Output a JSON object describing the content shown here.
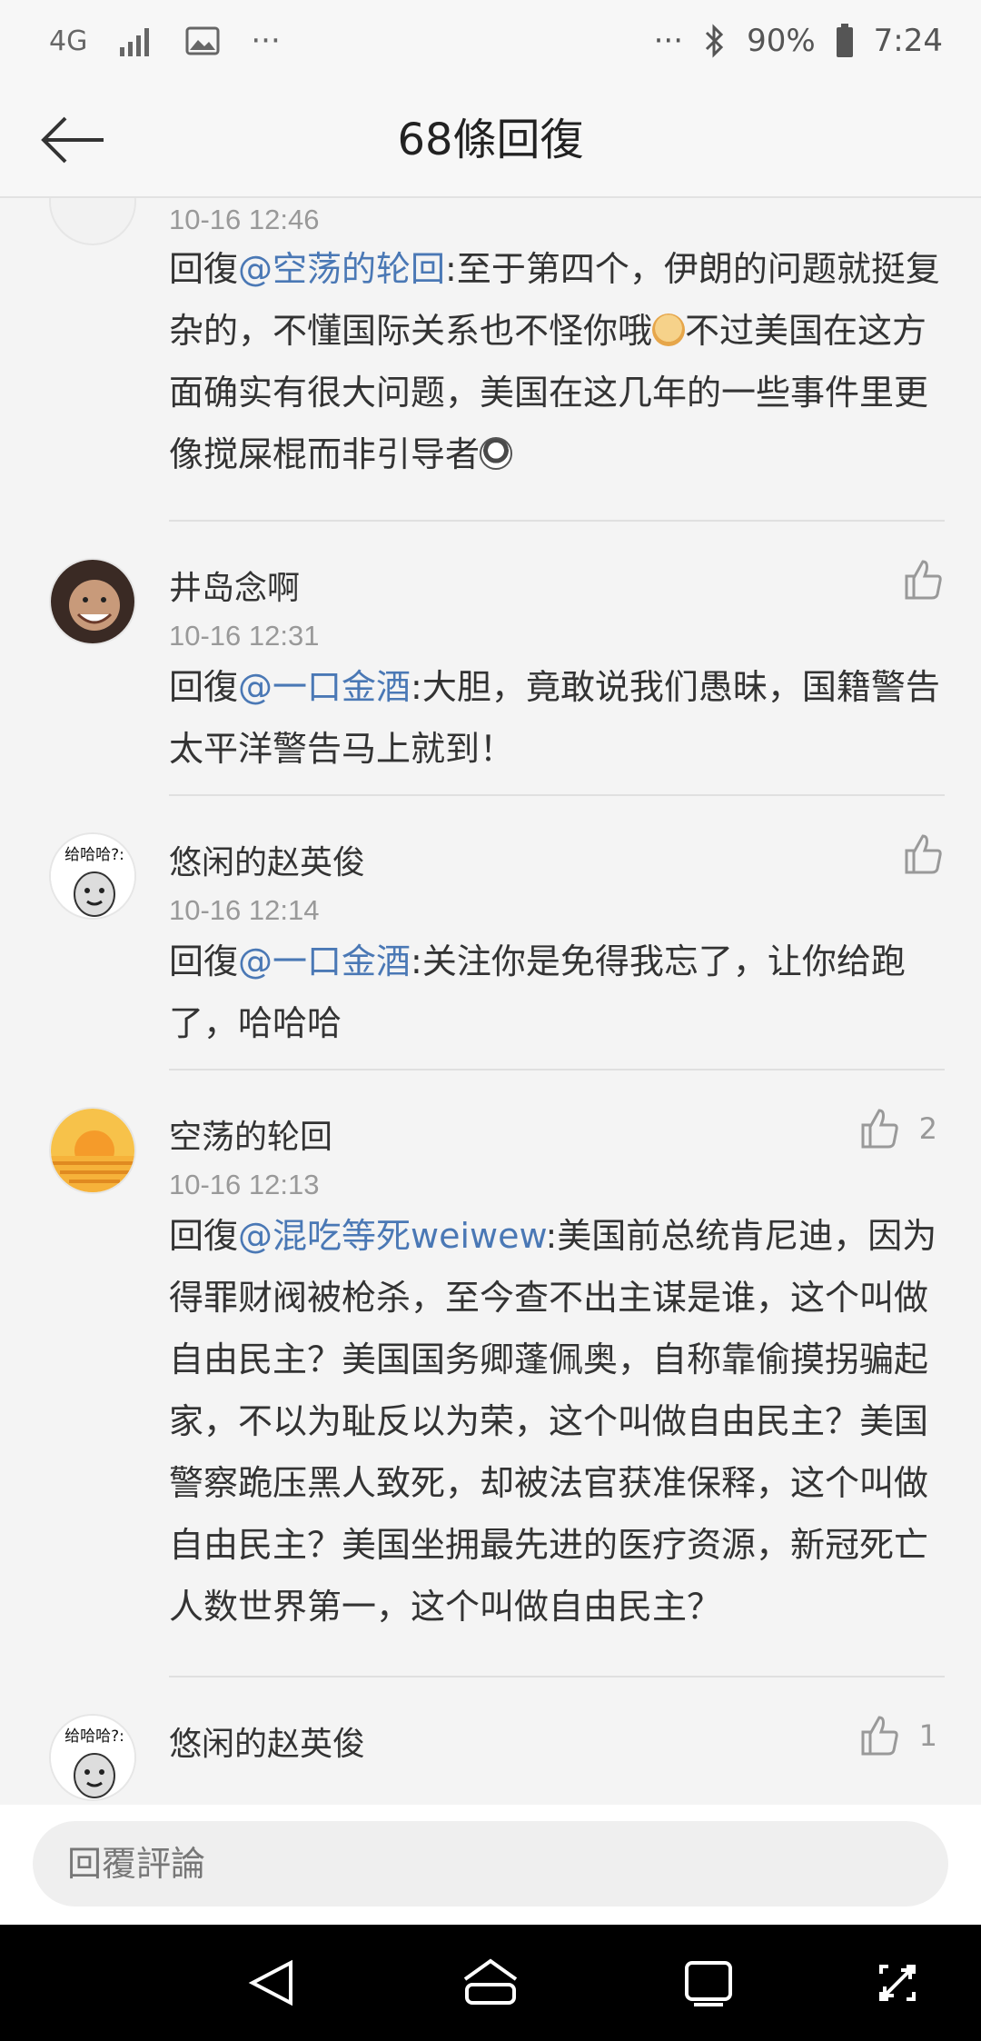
{
  "status_bar": {
    "network": "4G",
    "more_left": "···",
    "more_right": "···",
    "battery": "90%",
    "time": "7:24"
  },
  "header": {
    "title": "68條回復"
  },
  "comments": [
    {
      "time": "10-16 12:46",
      "reply_prefix": "回復",
      "mention": "@空荡的轮回",
      "text": ":至于第四个，伊朗的问题就挺复杂的，不懂国际关系也不怪你哦",
      "text2": "不过美国在这方面确实有很大问题，美国在这几年的一些事件里更像搅屎棍而非引导者",
      "emoji1": "doge-emoji",
      "emoji2": "tongue-emoji"
    },
    {
      "user": "井岛念啊",
      "time": "10-16 12:31",
      "reply_prefix": "回復",
      "mention": "@一口金酒",
      "text": ":大胆，竟敢说我们愚昧，国籍警告太平洋警告马上就到！"
    },
    {
      "user": "悠闲的赵英俊",
      "time": "10-16 12:14",
      "reply_prefix": "回復",
      "mention": "@一口金酒",
      "text": ":关注你是免得我忘了，让你给跑了，哈哈哈"
    },
    {
      "user": "空荡的轮回",
      "time": "10-16 12:13",
      "likes": "2",
      "reply_prefix": "回復",
      "mention": "@混吃等死weiwew",
      "text": ":美国前总统肯尼迪，因为得罪财阀被枪杀，至今查不出主谋是谁，这个叫做自由民主？美国国务卿蓬佩奥，自称靠偷摸拐骗起家，不以为耻反以为荣，这个叫做自由民主？美国警察跪压黑人致死，却被法官获准保释，这个叫做自由民主？美国坐拥最先进的医疗资源，新冠死亡人数世界第一，这个叫做自由民主？"
    },
    {
      "user": "悠闲的赵英俊",
      "likes": "1"
    }
  ],
  "avatar_text": "给哈哈?:",
  "reply_bar": {
    "placeholder": "回覆評論"
  },
  "colors": {
    "mention": "#4a78b5",
    "background": "#f4f4f4",
    "nav_bar": "#000000"
  }
}
